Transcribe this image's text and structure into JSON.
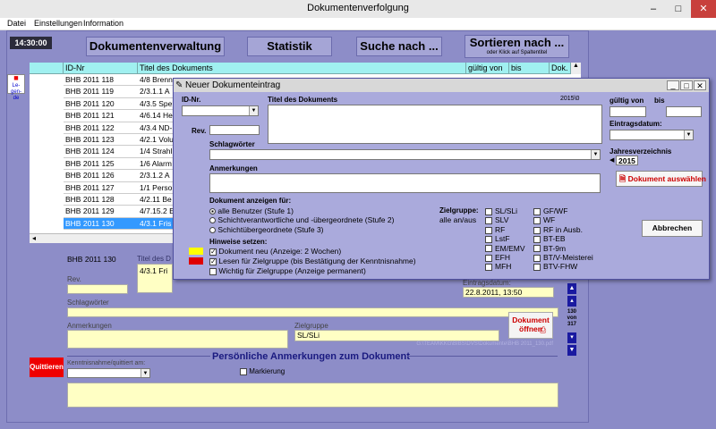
{
  "window": {
    "title": "Dokumentenverfolgung",
    "min": "–",
    "max": "□",
    "close": "✕"
  },
  "menu": [
    "Datei",
    "Einstellungen",
    "Information"
  ],
  "clock": "14:30:00",
  "toolbar": {
    "btn1": "Dokumentenverwaltung",
    "btn2": "Statistik",
    "btn3": "Suche nach ...",
    "btn4": "Sortieren nach ...",
    "btn4_sub": "oder Klick auf Spaltentitel"
  },
  "legend_icon": "Le-gen-de",
  "grid": {
    "headers": [
      "ID-Nr",
      "Titel des Dokuments",
      "gültig von",
      "bis",
      "Dok."
    ],
    "rows": [
      [
        "BHB 2011 118",
        "4/8 Brenn"
      ],
      [
        "BHB 2011 119",
        "2/3.1.1 A"
      ],
      [
        "BHB 2011 120",
        "4/3.5 Spe"
      ],
      [
        "BHB 2011 121",
        "4/6.14 He"
      ],
      [
        "BHB 2011 122",
        "4/3.4 ND-"
      ],
      [
        "BHB 2011 123",
        "4/2.1 Volu"
      ],
      [
        "BHB 2011 124",
        "1/4 Strahl"
      ],
      [
        "BHB 2011 125",
        "1/6 Alarm"
      ],
      [
        "BHB 2011 126",
        "2/3.1.2 A"
      ],
      [
        "BHB 2011 127",
        "1/1 Perso"
      ],
      [
        "BHB 2011 128",
        "4/2.11 Be"
      ],
      [
        "BHB 2011 129",
        "4/7.15.2 E"
      ],
      [
        "BHB 2011 130",
        "4/3.1 Fris"
      ]
    ],
    "selected_row": 12
  },
  "detail": {
    "id": "BHB 2011 130",
    "title_label": "Titel des D",
    "title_value": "4/3.1 Fri",
    "rev_label": "Rev.",
    "schlag_label": "Schlagwörter",
    "anm_label": "Anmerkungen",
    "ziel_label": "Zielgruppe",
    "ziel_value": "SL/SLi",
    "eintrag_label": "Eintragsdatum:",
    "eintrag_value": "22.8.2011, 13:50",
    "open_doc": "Dokument öffnen",
    "path": "G:\\TEAM\\KKG\\BIBS\\DVS\\Dokumente\\BHB 2011_130.pdf",
    "nav_count": "130",
    "nav_von": "von",
    "nav_total": "317",
    "quittieren": "Quittieren",
    "kenntnis_label": "Kenntnisnahme/quittiert am:",
    "pers_title": "Persönliche Anmerkungen zum Dokument",
    "markierung": "Markierung"
  },
  "dialog": {
    "title": "Neuer Dokumenteintrag",
    "min": "_",
    "max": "□",
    "close": "✕",
    "id_label": "ID-Nr.",
    "rev_label": "Rev.",
    "title_label": "Titel des Dokuments",
    "counter": "2015\\0",
    "von_label": "gültig von",
    "bis_label": "bis",
    "eintrag_label": "Eintragsdatum:",
    "jahr_label": "Jahresverzeichnis",
    "jahr_value": "2015",
    "schlag_label": "Schlagwörter",
    "anm_label": "Anmerkungen",
    "anzeigen_label": "Dokument anzeigen für:",
    "radios": [
      "alle Benutzer (Stufe 1)",
      "Schichtverantwortliche und -übergeordnete (Stufe 2)",
      "Schichtübergeordnete (Stufe 3)"
    ],
    "hinweise_label": "Hinweise setzen:",
    "hinweise": [
      "Dokument neu (Anzeige: 2 Wochen)",
      "Lesen für Zielgruppe (bis Bestätigung der Kenntnisnahme)",
      "Wichtig für Zielgruppe (Anzeige permanent)"
    ],
    "ziel_label": "Zielgruppe:",
    "alle_label": "alle an/aus",
    "ziel_col1": [
      "SL/SLi",
      "SLV",
      "RF",
      "LstF",
      "EM/EMV",
      "EFH",
      "MFH"
    ],
    "ziel_col2": [
      "GF/WF",
      "WF",
      "RF in Ausb.",
      "BT-EB",
      "BT-9m",
      "BT/V-Meisterei",
      "BTV-FHW"
    ],
    "select_doc": "Dokument auswählen",
    "cancel": "Abbrechen"
  },
  "colors": {
    "yellow_flag": "#ffff00",
    "red_flag": "#e00000"
  }
}
